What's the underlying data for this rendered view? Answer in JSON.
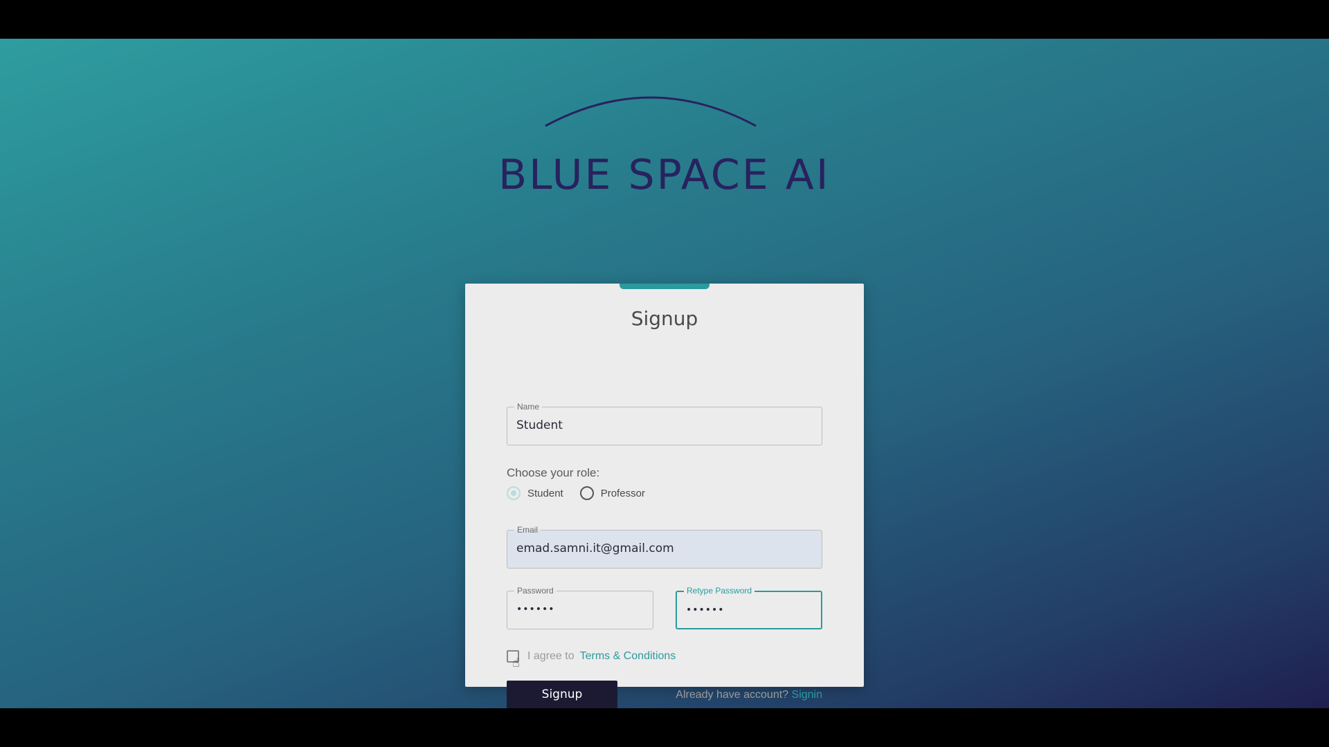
{
  "logo": {
    "text": "BLUE SPACE AI",
    "color": "#28225e"
  },
  "form": {
    "title": "Signup",
    "name": {
      "label": "Name",
      "value": "Student"
    },
    "role": {
      "label": "Choose your role:",
      "options": [
        "Student",
        "Professor"
      ],
      "selected": "Student"
    },
    "email": {
      "label": "Email",
      "value": "emad.samni.it@gmail.com"
    },
    "password": {
      "label": "Password",
      "value": "••••••"
    },
    "retype_password": {
      "label": "Retype Password",
      "value": "••••••"
    },
    "agree": {
      "prefix": "I agree to",
      "link": "Terms & Conditions",
      "checked": false
    },
    "submit_label": "Signup",
    "signin_prompt": "Already have account?",
    "signin_link": "Signin"
  },
  "colors": {
    "accent": "#2b9a9e",
    "button": "#1c1a33",
    "card": "#ececec"
  },
  "icons": {
    "cursor": "hand-pointer-icon",
    "logo_arc": "arc-icon"
  }
}
